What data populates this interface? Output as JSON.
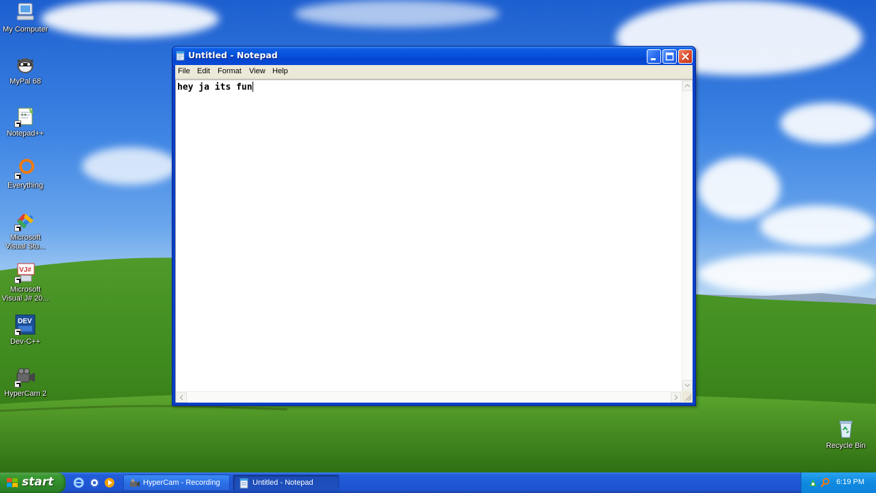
{
  "desktop": {
    "icons": [
      {
        "label": "My Computer",
        "icon": "my-computer-icon"
      },
      {
        "label": "MyPal 68",
        "icon": "mypal-browser-icon"
      },
      {
        "label": "Notepad++",
        "icon": "notepadpp-icon"
      },
      {
        "label": "Everything",
        "icon": "everything-search-icon"
      },
      {
        "label": "Microsoft Visual Stu...",
        "icon": "visual-studio-icon"
      },
      {
        "label": "Microsoft Visual J# 20...",
        "icon": "visual-jsharp-icon"
      },
      {
        "label": "Dev-C++",
        "icon": "devcpp-icon"
      },
      {
        "label": "HyperCam 2",
        "icon": "hypercam-icon"
      }
    ],
    "recycle_bin": {
      "label": "Recycle Bin",
      "icon": "recycle-bin-icon"
    }
  },
  "window": {
    "title": "Untitled - Notepad",
    "menu": [
      "File",
      "Edit",
      "Format",
      "View",
      "Help"
    ],
    "content": "hey ja its fun"
  },
  "taskbar": {
    "start_label": "start",
    "tasks": [
      {
        "label": "HyperCam - Recording",
        "active": false
      },
      {
        "label": "Untitled - Notepad",
        "active": true
      }
    ],
    "clock": "6:19 PM"
  },
  "colors": {
    "titlebar": "#0653dc",
    "taskbar": "#245edb",
    "start_button": "#3c9b34",
    "tray": "#0f8ae0",
    "close_button": "#d84a2a"
  }
}
